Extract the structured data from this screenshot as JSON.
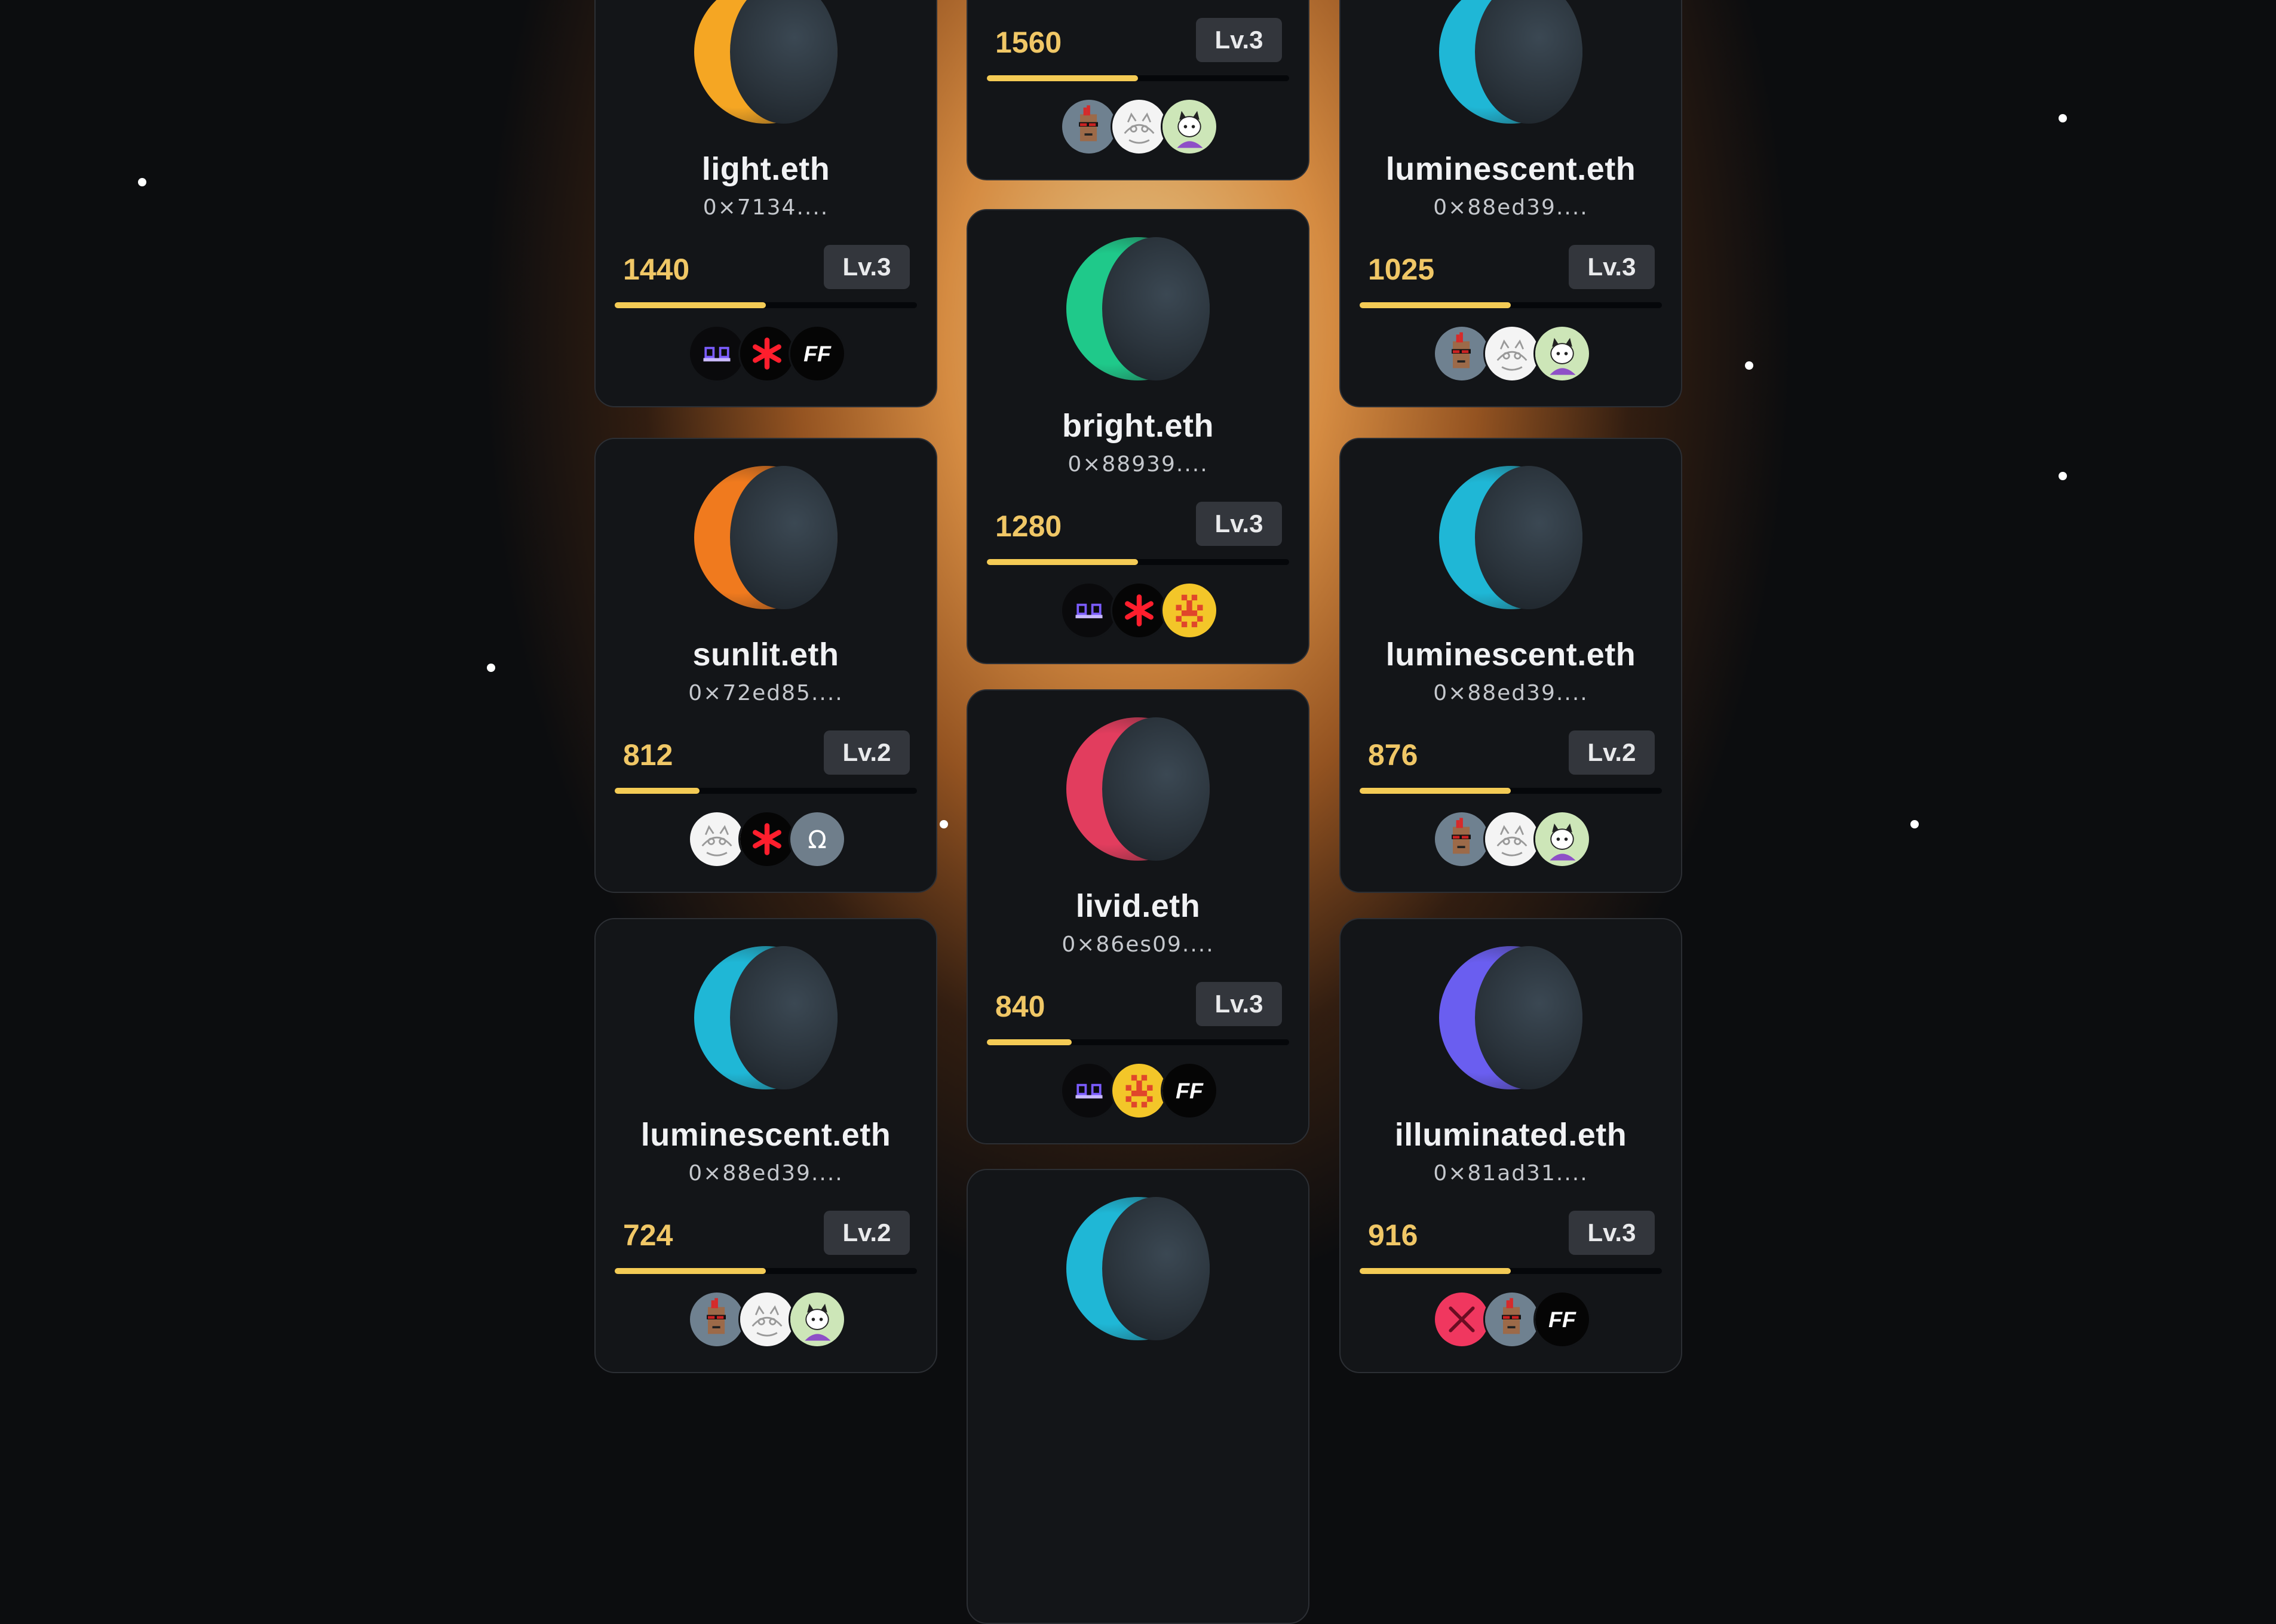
{
  "colors": {
    "background": "#0c0d0f",
    "glow": "#e8964a",
    "card": "#131518",
    "score": "#f0c766",
    "progress": "#f4cb55",
    "level_badge": "#33363c"
  },
  "cards": [
    {
      "id": "c1",
      "name": "light.eth",
      "address": "0×7134....",
      "score": "1440",
      "level": "Lv.3",
      "progress": 0.5,
      "moon_color": "#f5a623",
      "avatars": [
        "gg-logo",
        "red-asterisk",
        "ff-logo"
      ]
    },
    {
      "id": "c2",
      "name": "",
      "address": "",
      "score": "1560",
      "level": "Lv.3",
      "progress": 0.5,
      "moon_color": "",
      "avatars": [
        "punk-avatar",
        "sketch-cat-avatar",
        "cartoon-cat-avatar"
      ]
    },
    {
      "id": "c3",
      "name": "luminescent.eth",
      "address": "0×88ed39....",
      "score": "1025",
      "level": "Lv.3",
      "progress": 0.5,
      "moon_color": "#1fb7d6",
      "avatars": [
        "punk-avatar",
        "sketch-cat-avatar",
        "cartoon-cat-avatar"
      ]
    },
    {
      "id": "c4",
      "name": "bright.eth",
      "address": "0×88939....",
      "score": "1280",
      "level": "Lv.3",
      "progress": 0.5,
      "moon_color": "#1fc98a",
      "avatars": [
        "gg-logo",
        "red-asterisk",
        "pixel-yellow-logo"
      ]
    },
    {
      "id": "c5",
      "name": "sunlit.eth",
      "address": "0×72ed85....",
      "score": "812",
      "level": "Lv.2",
      "progress": 0.28,
      "moon_color": "#f07a1e",
      "avatars": [
        "sketch-cat-avatar",
        "red-asterisk",
        "omega-logo"
      ]
    },
    {
      "id": "c6",
      "name": "luminescent.eth",
      "address": "0×88ed39....",
      "score": "876",
      "level": "Lv.2",
      "progress": 0.5,
      "moon_color": "#1fb7d6",
      "avatars": [
        "punk-avatar",
        "sketch-cat-avatar",
        "cartoon-cat-avatar"
      ]
    },
    {
      "id": "c7",
      "name": "livid.eth",
      "address": "0×86es09....",
      "score": "840",
      "level": "Lv.3",
      "progress": 0.28,
      "moon_color": "#e23d5e",
      "avatars": [
        "gg-logo",
        "pixel-yellow-logo",
        "ff-logo"
      ]
    },
    {
      "id": "c8",
      "name": "luminescent.eth",
      "address": "0×88ed39....",
      "score": "724",
      "level": "Lv.2",
      "progress": 0.5,
      "moon_color": "#1fb7d6",
      "avatars": [
        "punk-avatar",
        "sketch-cat-avatar",
        "cartoon-cat-avatar"
      ]
    },
    {
      "id": "c9",
      "name": "illuminated.eth",
      "address": "0×81ad31....",
      "score": "916",
      "level": "Lv.3",
      "progress": 0.5,
      "moon_color": "#6a5ef0",
      "avatars": [
        "crossed-swords-logo",
        "punk-avatar",
        "ff-logo"
      ]
    },
    {
      "id": "c10",
      "name": "",
      "address": "",
      "score": "",
      "level": "",
      "progress": 0,
      "moon_color": "#1fb7d6",
      "avatars": []
    }
  ],
  "avatar_labels": {
    "ff": "FF",
    "omega": "Ω",
    "asterisk": "*",
    "gg": "ᗡᗡ"
  }
}
